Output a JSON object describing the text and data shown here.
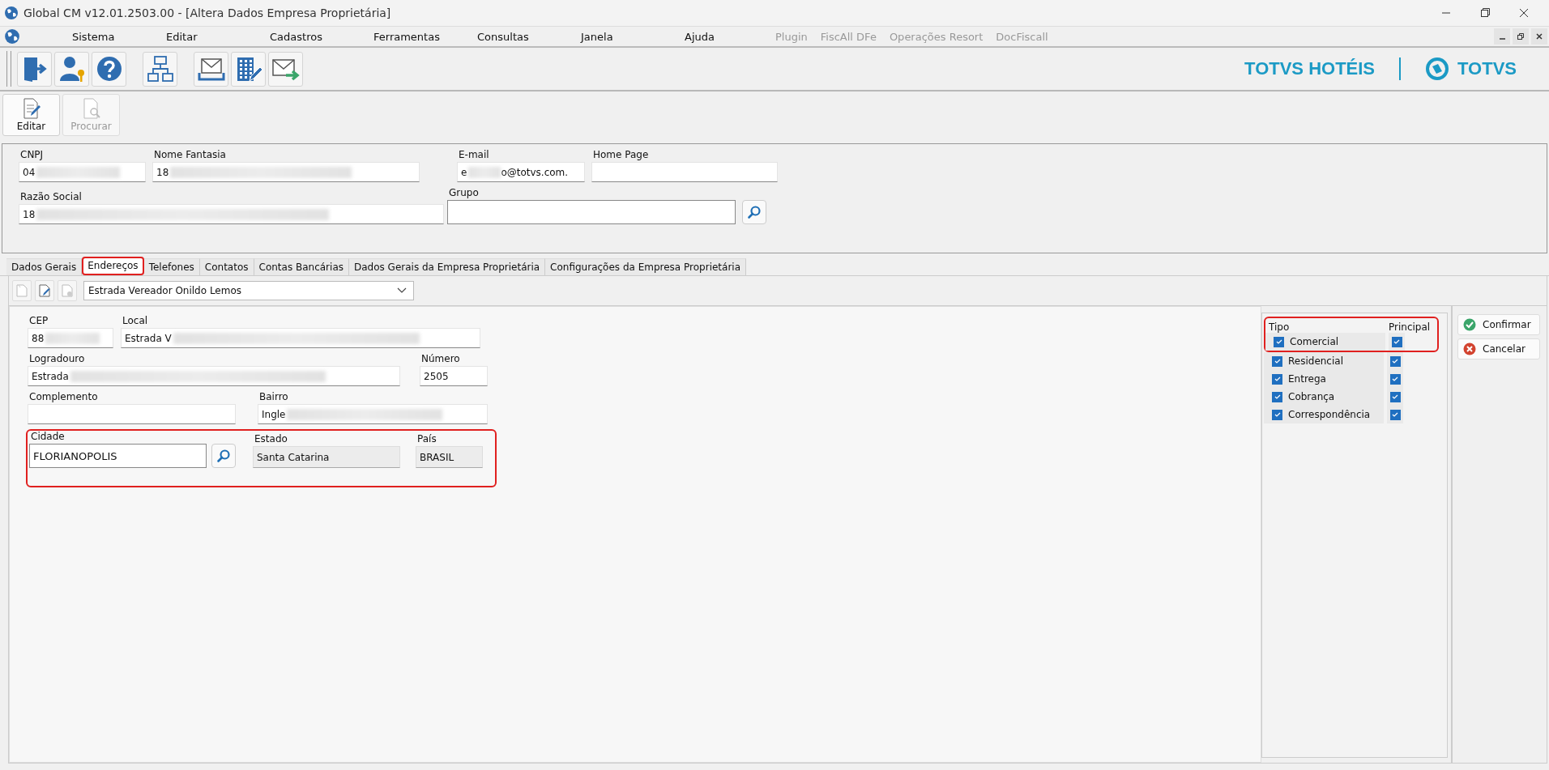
{
  "window": {
    "title": "Global CM v12.01.2503.00 - [Altera Dados Empresa Proprietária]"
  },
  "menu": [
    {
      "label": "Sistema",
      "disabled": false
    },
    {
      "label": "Editar",
      "disabled": false
    },
    {
      "label": "Cadastros",
      "disabled": false
    },
    {
      "label": "Ferramentas",
      "disabled": false
    },
    {
      "label": "Consultas",
      "disabled": false
    },
    {
      "label": "Janela",
      "disabled": false
    },
    {
      "label": "Ajuda",
      "disabled": false
    },
    {
      "label": "Plugin",
      "disabled": true
    },
    {
      "label": "FiscAll DFe",
      "disabled": true
    },
    {
      "label": "Operações Resort",
      "disabled": true
    },
    {
      "label": "DocFiscall",
      "disabled": true
    }
  ],
  "toolbar": [
    {
      "kind": "exit"
    },
    {
      "kind": "user-key"
    },
    {
      "kind": "help"
    },
    {
      "kind": "org"
    },
    {
      "kind": "inbox"
    },
    {
      "kind": "building-edit"
    },
    {
      "kind": "mail-send"
    }
  ],
  "brand": {
    "product": "TOTVS HOTÉIS",
    "company": "TOTVS"
  },
  "actions": [
    {
      "label": "Editar",
      "kind": "edit",
      "disabled": false
    },
    {
      "label": "Procurar",
      "kind": "search",
      "disabled": true
    }
  ],
  "company": {
    "fields": [
      {
        "label": "CNPJ",
        "value": "04",
        "redacted": true
      },
      {
        "label": "Nome Fantasia",
        "value": "18",
        "redacted": true
      },
      {
        "label": "E-mail",
        "value": "e",
        "redacted": true,
        "suffix": "o@totvs.com."
      },
      {
        "label": "Home Page",
        "redacted": false
      },
      {
        "label": "Razão Social",
        "value": "18",
        "redacted": true
      },
      {
        "label": "Grupo",
        "redacted": false
      }
    ]
  },
  "tabs": [
    {
      "label": "Dados Gerais",
      "selected": false,
      "highlighted": false
    },
    {
      "label": "Endereços",
      "selected": true,
      "highlighted": true
    },
    {
      "label": "Telefones",
      "selected": false,
      "highlighted": false
    },
    {
      "label": "Contatos",
      "selected": false,
      "highlighted": false
    },
    {
      "label": "Contas Bancárias",
      "selected": false,
      "highlighted": false
    },
    {
      "label": "Dados Gerais da Empresa Proprietária",
      "selected": false,
      "highlighted": false
    },
    {
      "label": "Configurações da Empresa Proprietária",
      "selected": false,
      "highlighted": false
    }
  ],
  "address": {
    "tools": [
      {
        "kind": "new",
        "disabled": true
      },
      {
        "kind": "edit",
        "disabled": false
      },
      {
        "kind": "delete",
        "disabled": true
      }
    ],
    "selector": "Estrada Vereador Onildo Lemos",
    "fields": [
      {
        "label": "CEP",
        "value": "88",
        "redacted": true,
        "readonly": false
      },
      {
        "label": "Local",
        "value": "Estrada V",
        "redacted": true,
        "readonly": false
      },
      {
        "label": "Logradouro",
        "value": "Estrada",
        "redacted": true,
        "readonly": false
      },
      {
        "label": "Número",
        "value": "2505",
        "redacted": false,
        "readonly": false
      },
      {
        "label": "Complemento",
        "redacted": false,
        "readonly": false
      },
      {
        "label": "Bairro",
        "value": "Ingle",
        "redacted": true,
        "readonly": false
      },
      {
        "label": "Cidade",
        "value": "FLORIANOPOLIS",
        "redacted": false,
        "readonly": false
      },
      {
        "label": "Estado",
        "value": "Santa Catarina",
        "redacted": false,
        "readonly": true
      },
      {
        "label": "País",
        "value": "BRASIL",
        "redacted": false,
        "readonly": true
      }
    ],
    "city_highlighted": true
  },
  "types": {
    "headers": [
      "Tipo",
      "Principal"
    ],
    "rows": [
      {
        "label": "Comercial",
        "checked": true,
        "principal": true,
        "highlighted": true
      },
      {
        "label": "Residencial",
        "checked": true,
        "principal": true,
        "highlighted": false
      },
      {
        "label": "Entrega",
        "checked": true,
        "principal": true,
        "highlighted": false
      },
      {
        "label": "Cobrança",
        "checked": true,
        "principal": true,
        "highlighted": false
      },
      {
        "label": "Correspondência",
        "checked": true,
        "principal": true,
        "highlighted": false
      }
    ]
  },
  "buttons": [
    {
      "label": "Confirmar",
      "kind": "confirm"
    },
    {
      "label": "Cancelar",
      "kind": "cancel"
    }
  ]
}
